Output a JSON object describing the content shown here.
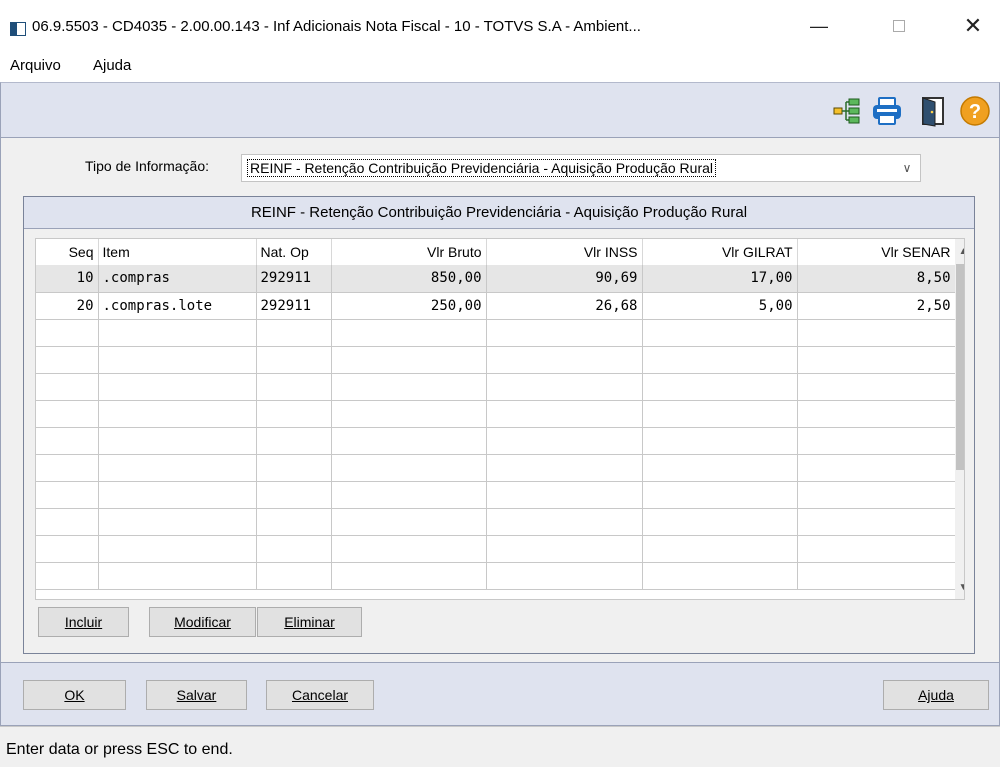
{
  "window": {
    "title": "06.9.5503 - CD4035 - 2.00.00.143 - Inf Adicionais Nota Fiscal - 10 - TOTVS S.A - Ambient...",
    "minimize_glyph": "—",
    "close_glyph": "✕"
  },
  "menu": {
    "items": [
      "Arquivo",
      "Ajuda"
    ]
  },
  "toolbar": {
    "icons": [
      "tree-icon",
      "printer-icon",
      "exit-icon",
      "help-icon"
    ],
    "help_glyph": "?"
  },
  "form": {
    "tipo_label": "Tipo de Informação:",
    "tipo_value": "REINF - Retenção Contribuição Previdenciária - Aquisição Produção Rural"
  },
  "panel": {
    "title": "REINF - Retenção Contribuição Previdenciária - Aquisição Produção Rural"
  },
  "grid": {
    "headers": [
      "Seq",
      "Item",
      "Nat. Op",
      "Vlr Bruto",
      "Vlr INSS",
      "Vlr GILRAT",
      "Vlr SENAR"
    ],
    "rows": [
      [
        "10",
        ".compras",
        "292911",
        "850,00",
        "90,69",
        "17,00",
        "8,50"
      ],
      [
        "20",
        ".compras.lote",
        "292911",
        "250,00",
        "26,68",
        "5,00",
        "2,50"
      ]
    ]
  },
  "grid_buttons": {
    "incluir": "Incluir",
    "modificar": "Modificar",
    "eliminar": "Eliminar"
  },
  "footer": {
    "ok": "OK",
    "salvar": "Salvar",
    "cancelar": "Cancelar",
    "ajuda": "Ajuda"
  },
  "status": {
    "text": "Enter data or press ESC to end."
  },
  "colors": {
    "toolbar_bg": "#dfe3ef",
    "selected_row": "#e6e6e6",
    "help_orange": "#f0a020",
    "printer_blue": "#1e6fc4"
  }
}
